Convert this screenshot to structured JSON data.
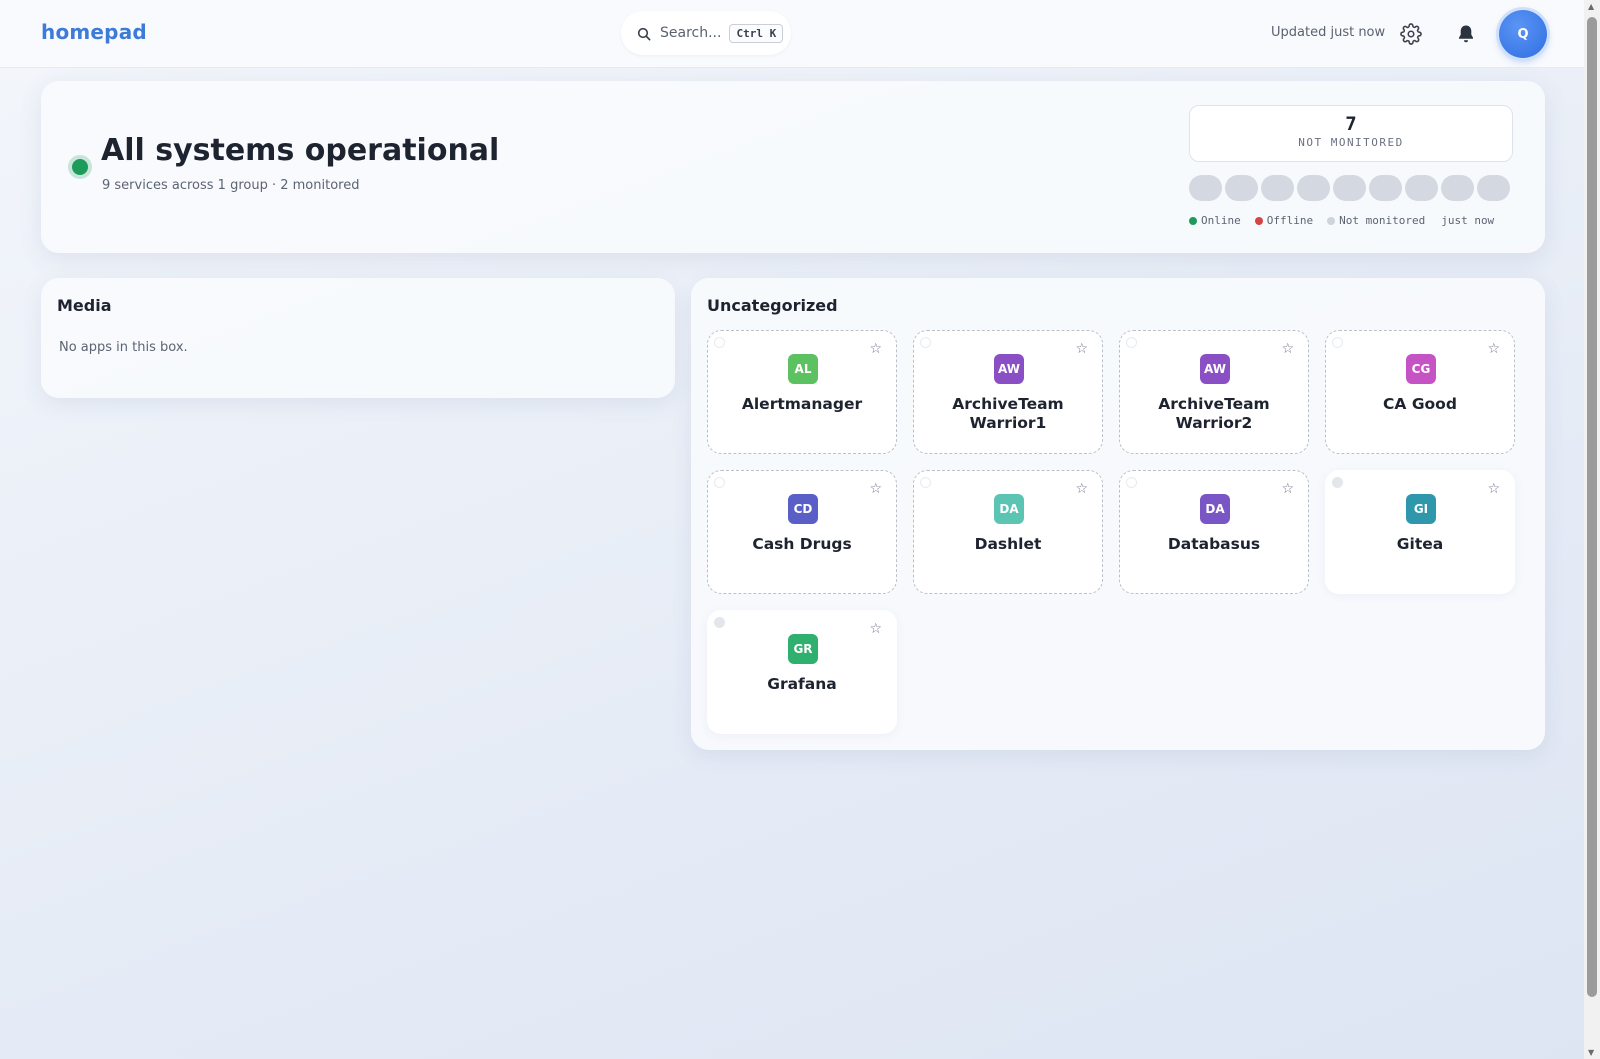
{
  "topbar": {
    "brand": "homepad",
    "search_placeholder": "Search...",
    "search_shortcut": "Ctrl K",
    "updated_text": "Updated just now",
    "avatar_initial": "Q"
  },
  "status": {
    "title": "All systems operational",
    "subtitle": "9 services across 1 group · 2 monitored",
    "counter_value": "7",
    "counter_label": "NOT MONITORED",
    "pill_count": 9,
    "legend": {
      "online": "Online",
      "offline": "Offline",
      "not_monitored": "Not monitored",
      "time": "just now"
    },
    "colors": {
      "online": "#1e9a5a",
      "offline": "#d64545",
      "not_monitored": "#cfd4dc"
    }
  },
  "boxes": {
    "media": {
      "title": "Media",
      "empty_text": "No apps in this box."
    },
    "uncategorized": {
      "title": "Uncategorized",
      "apps": [
        {
          "initials": "AL",
          "name": "Alertmanager",
          "color": "#5cc160",
          "monitored": false
        },
        {
          "initials": "AW",
          "name": "ArchiveTeam Warrior1",
          "color": "#8a4fc4",
          "monitored": false
        },
        {
          "initials": "AW",
          "name": "ArchiveTeam Warrior2",
          "color": "#8a4fc4",
          "monitored": false
        },
        {
          "initials": "CG",
          "name": "CA Good",
          "color": "#c653c3",
          "monitored": false
        },
        {
          "initials": "CD",
          "name": "Cash Drugs",
          "color": "#5a5fc8",
          "monitored": false
        },
        {
          "initials": "DA",
          "name": "Dashlet",
          "color": "#5cc4b2",
          "monitored": false
        },
        {
          "initials": "DA",
          "name": "Databasus",
          "color": "#7a55c6",
          "monitored": false
        },
        {
          "initials": "GI",
          "name": "Gitea",
          "color": "#2f97ab",
          "monitored": true
        },
        {
          "initials": "GR",
          "name": "Grafana",
          "color": "#2fb06e",
          "monitored": true
        }
      ]
    }
  }
}
